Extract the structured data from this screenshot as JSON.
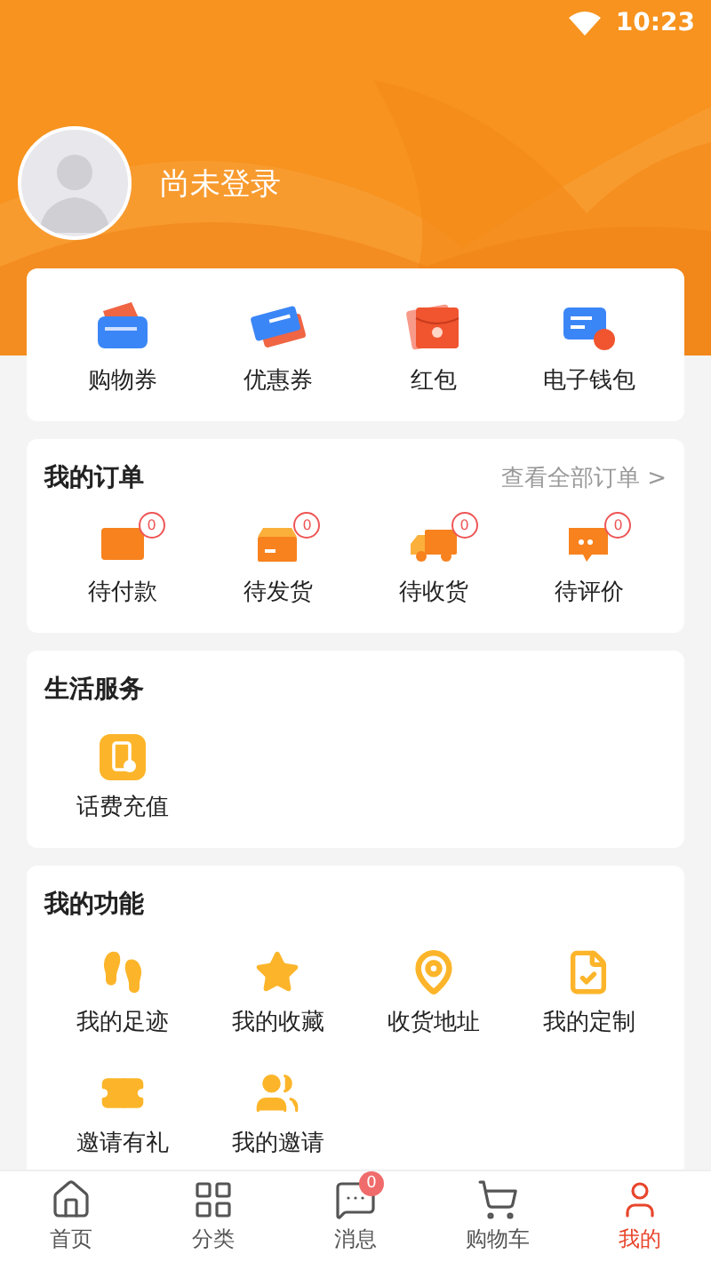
{
  "status_bar": {
    "time": "10:23"
  },
  "profile": {
    "name": "尚未登录"
  },
  "wallet": [
    {
      "label": "购物券"
    },
    {
      "label": "优惠券"
    },
    {
      "label": "红包"
    },
    {
      "label": "电子钱包"
    }
  ],
  "orders": {
    "title": "我的订单",
    "link": "查看全部订单 >",
    "items": [
      {
        "label": "待付款",
        "badge": "0"
      },
      {
        "label": "待发货",
        "badge": "0"
      },
      {
        "label": "待收货",
        "badge": "0"
      },
      {
        "label": "待评价",
        "badge": "0"
      }
    ]
  },
  "services": {
    "title": "生活服务",
    "items": [
      {
        "label": "话费充值"
      }
    ]
  },
  "functions": {
    "title": "我的功能",
    "items": [
      {
        "label": "我的足迹"
      },
      {
        "label": "我的收藏"
      },
      {
        "label": "收货地址"
      },
      {
        "label": "我的定制"
      },
      {
        "label": "邀请有礼"
      },
      {
        "label": "我的邀请"
      }
    ]
  },
  "tab_bar": [
    {
      "label": "首页",
      "selected": false
    },
    {
      "label": "分类",
      "selected": false
    },
    {
      "label": "消息",
      "selected": false,
      "badge": "0"
    },
    {
      "label": "购物车",
      "selected": false
    },
    {
      "label": "我的",
      "selected": true
    }
  ]
}
